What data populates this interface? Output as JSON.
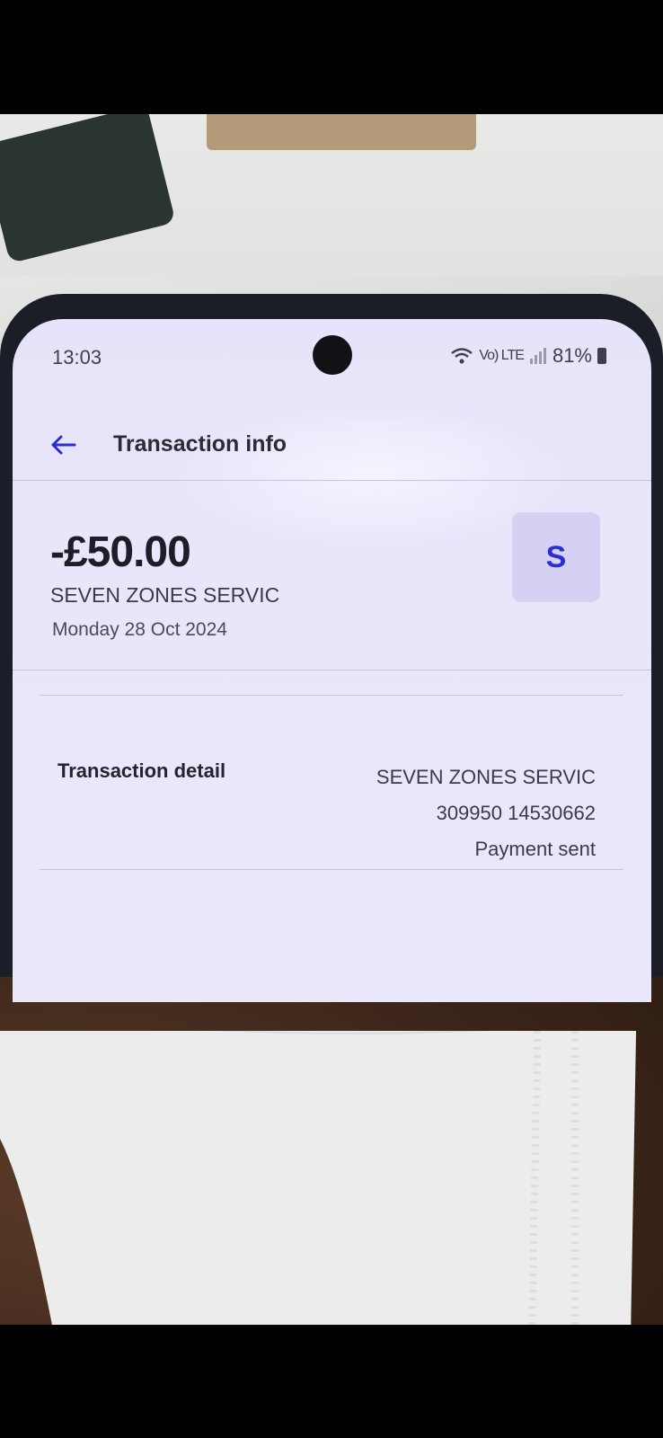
{
  "status_bar": {
    "time": "13:03",
    "signal_text": "Vo) LTE",
    "battery": "81%"
  },
  "header": {
    "back_icon": "arrow-left-icon",
    "title": "Transaction info"
  },
  "transaction": {
    "amount": "-£50.00",
    "merchant": "SEVEN ZONES SERVIC",
    "date": "Monday 28 Oct 2024",
    "avatar_letter": "S"
  },
  "detail": {
    "label": "Transaction detail",
    "name": "SEVEN ZONES SERVIC",
    "reference": "309950 14530662",
    "status": "Payment sent"
  },
  "colors": {
    "accent": "#2a2fd0",
    "screen_bg": "#e9e6fb",
    "avatar_bg": "#d5d1f3"
  }
}
